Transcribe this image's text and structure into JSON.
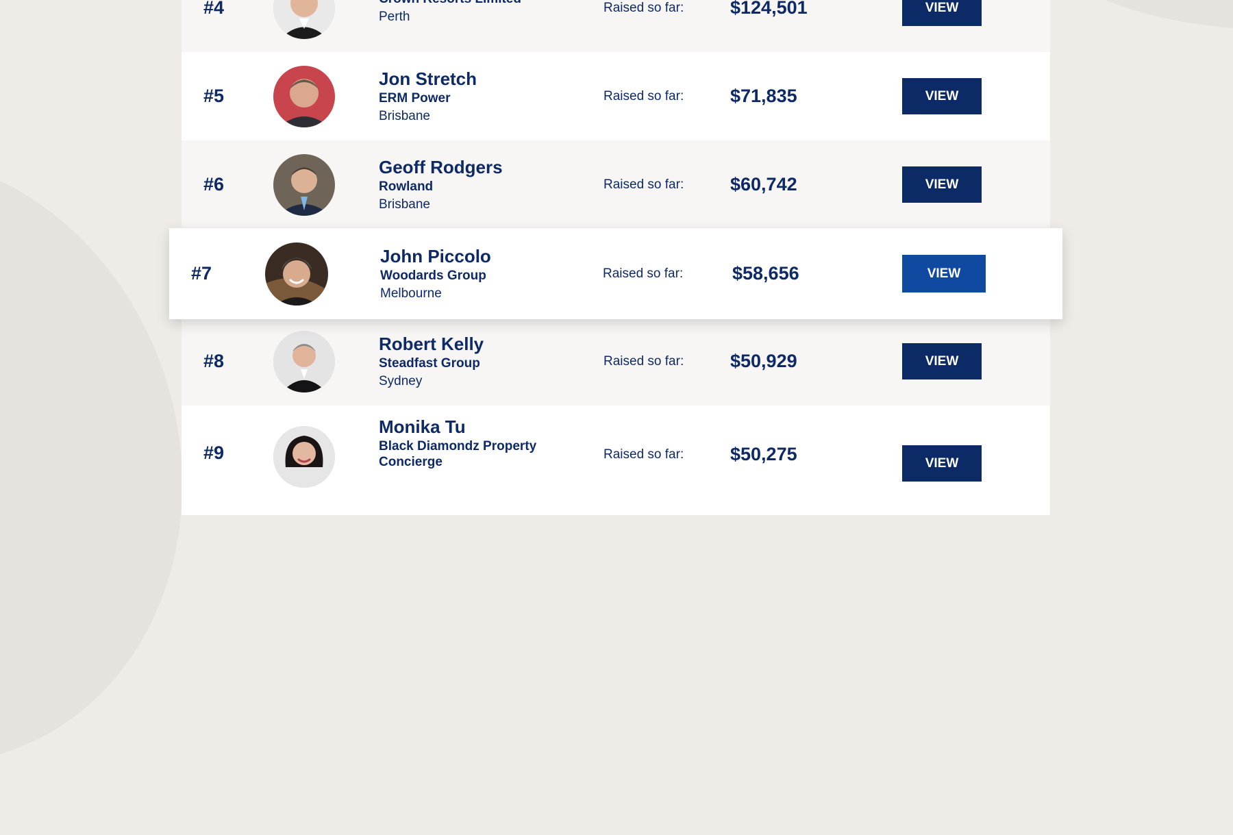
{
  "raised_label": "Raised so far:",
  "view_label": "VIEW",
  "rows": [
    {
      "rank": "#4",
      "name": "",
      "company": "Crown Resorts Limited",
      "city": "Perth",
      "amount": "$124,501"
    },
    {
      "rank": "#5",
      "name": "Jon Stretch",
      "company": "ERM Power",
      "city": "Brisbane",
      "amount": "$71,835"
    },
    {
      "rank": "#6",
      "name": "Geoff Rodgers",
      "company": "Rowland",
      "city": "Brisbane",
      "amount": "$60,742"
    },
    {
      "rank": "#7",
      "name": "John Piccolo",
      "company": "Woodards Group",
      "city": "Melbourne",
      "amount": "$58,656"
    },
    {
      "rank": "#8",
      "name": "Robert Kelly",
      "company": "Steadfast Group",
      "city": "Sydney",
      "amount": "$50,929"
    },
    {
      "rank": "#9",
      "name": "Monika Tu",
      "company": "Black Diamondz Property Concierge",
      "city": "",
      "amount": "$50,275"
    }
  ],
  "colors": {
    "navy": "#0c2a66",
    "featured_button": "#0f4aa0",
    "page_bg": "#efece7",
    "row_light": "#f7f6f4"
  }
}
